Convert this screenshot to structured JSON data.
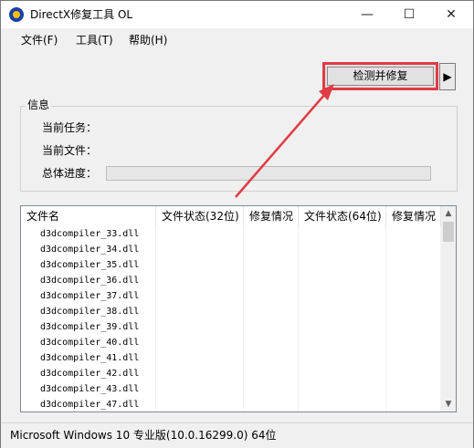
{
  "window": {
    "title": "DirectX修复工具 OL",
    "minimize_icon": "minimize-icon",
    "maximize_icon": "maximize-icon",
    "close_icon": "close-icon"
  },
  "menu": [
    "文件(F)",
    "工具(T)",
    "帮助(H)"
  ],
  "toolbar": {
    "detect_label": "检测并修复",
    "dropdown_glyph": "▶",
    "highlight_color": "#e03c45"
  },
  "info": {
    "group_title": "信息",
    "current_task_label": "当前任务：",
    "current_file_label": "当前文件：",
    "progress_label": "总体进度：",
    "progress_value": 0
  },
  "table": {
    "headers": [
      "文件名",
      "文件状态(32位)",
      "修复情况",
      "文件状态(64位)",
      "修复情况"
    ],
    "rows": [
      "d3dcompiler_33.dll",
      "d3dcompiler_34.dll",
      "d3dcompiler_35.dll",
      "d3dcompiler_36.dll",
      "d3dcompiler_37.dll",
      "d3dcompiler_38.dll",
      "d3dcompiler_39.dll",
      "d3dcompiler_40.dll",
      "d3dcompiler_41.dll",
      "d3dcompiler_42.dll",
      "d3dcompiler_43.dll",
      "d3dcompiler_47.dll"
    ]
  },
  "status": {
    "text": "Microsoft Windows 10 专业版(10.0.16299.0) 64位"
  }
}
